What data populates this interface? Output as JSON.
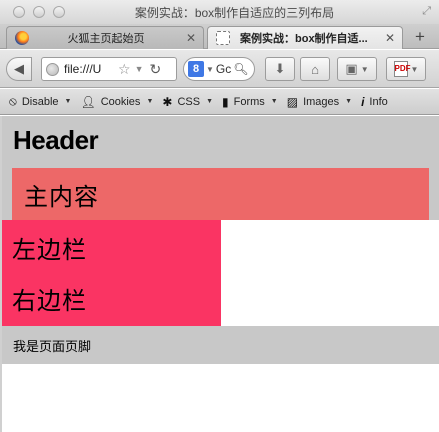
{
  "window": {
    "title": "案例实战：box制作自适应的三列布局"
  },
  "tabs": [
    {
      "label": "火狐主页起始页",
      "active": false
    },
    {
      "label": "案例实战：box制作自适...",
      "active": true
    }
  ],
  "toolbar": {
    "url": "file:///U",
    "search_placeholder": "Gc",
    "new_tab_symbol": "+"
  },
  "devbar": {
    "items": [
      {
        "label": "Disable",
        "icon": "no-entry-icon"
      },
      {
        "label": "Cookies",
        "icon": "person-icon"
      },
      {
        "label": "CSS",
        "icon": "gear-icon"
      },
      {
        "label": "Forms",
        "icon": "clipboard-icon"
      },
      {
        "label": "Images",
        "icon": "image-icon"
      },
      {
        "label": "Info",
        "icon": "info-icon"
      }
    ]
  },
  "page": {
    "header": "Header",
    "main": "主内容",
    "left_sidebar": "左边栏",
    "right_sidebar": "右边栏",
    "footer": "我是页面页脚"
  },
  "colors": {
    "main_bg": "#ed6868",
    "sidebar_bg": "#fa3463",
    "header_footer_bg": "#c8c8c8"
  }
}
